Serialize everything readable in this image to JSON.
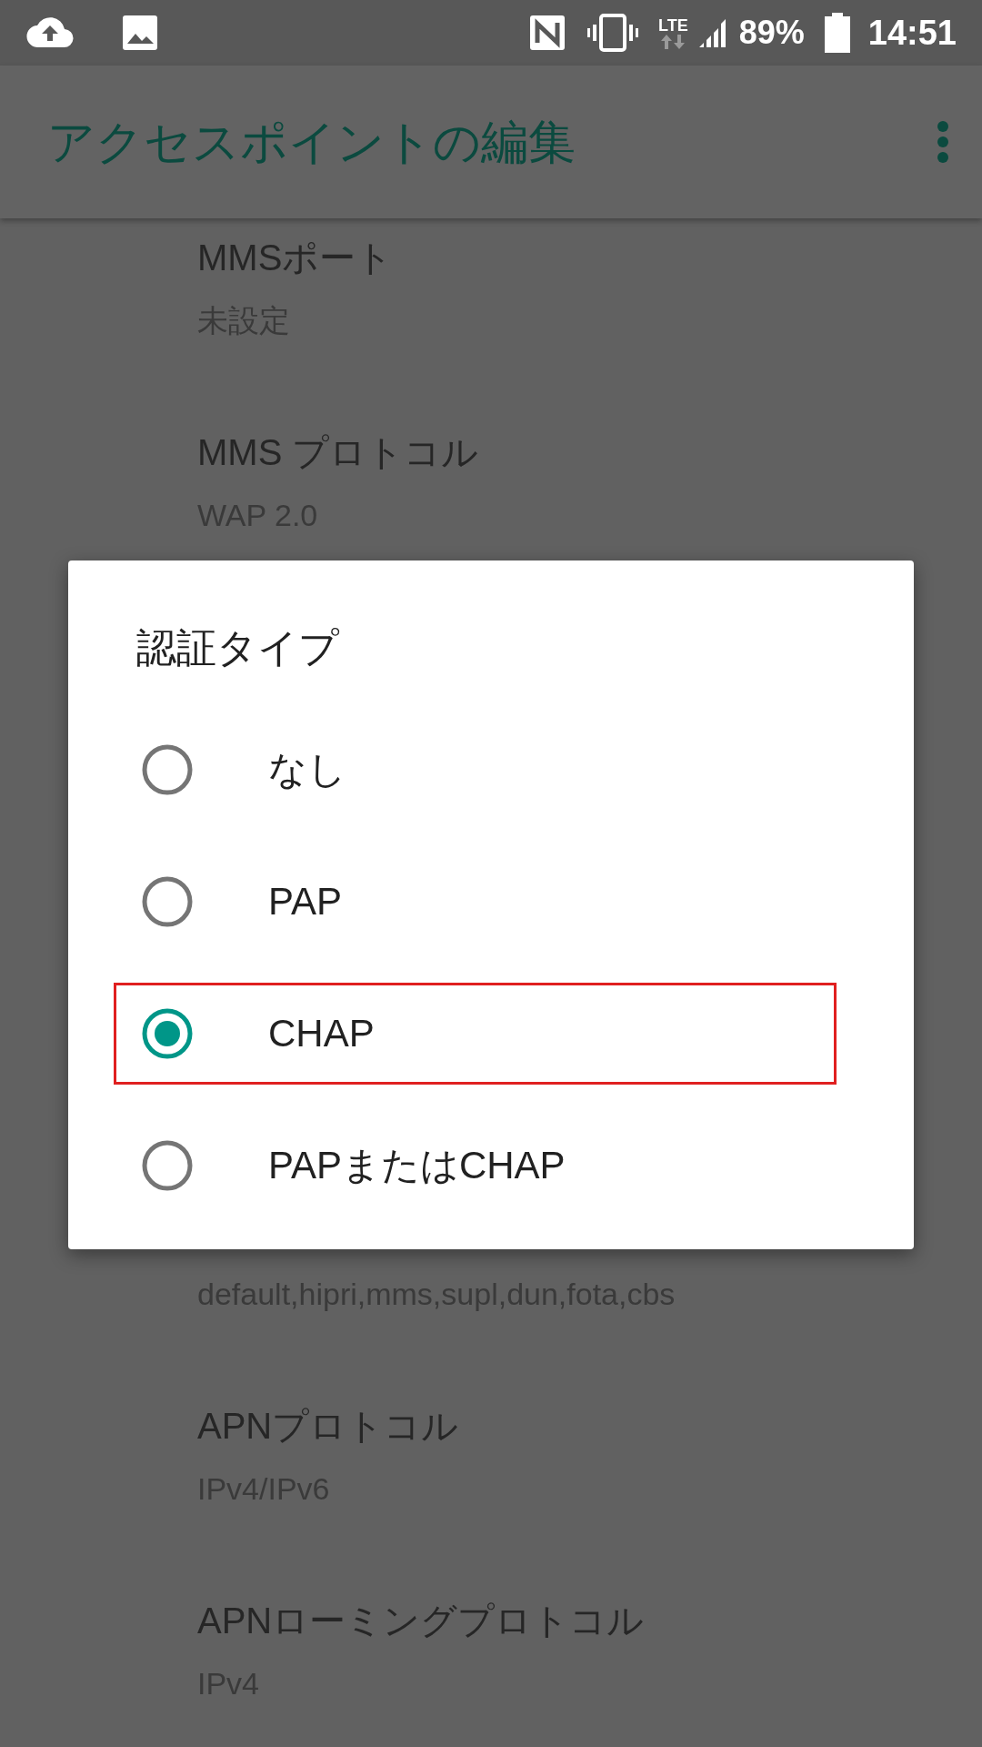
{
  "status_bar": {
    "network": "LTE",
    "battery": "89%",
    "time": "14:51"
  },
  "app_bar": {
    "title": "アクセスポイントの編集"
  },
  "settings": [
    {
      "title": "MMSポート",
      "summary": "未設定"
    },
    {
      "title": "MMS プロトコル",
      "summary": "WAP 2.0"
    },
    {
      "summary": "default,hipri,mms,supl,dun,fota,cbs"
    },
    {
      "title": "APNプロトコル",
      "summary": "IPv4/IPv6"
    },
    {
      "title": "APNローミングプロトコル",
      "summary": "IPv4"
    }
  ],
  "dialog": {
    "title": "認証タイプ",
    "options": [
      {
        "label": "なし",
        "selected": false,
        "highlighted": false
      },
      {
        "label": "PAP",
        "selected": false,
        "highlighted": false
      },
      {
        "label": "CHAP",
        "selected": true,
        "highlighted": true
      },
      {
        "label": "PAPまたはCHAP",
        "selected": false,
        "highlighted": false
      }
    ]
  }
}
